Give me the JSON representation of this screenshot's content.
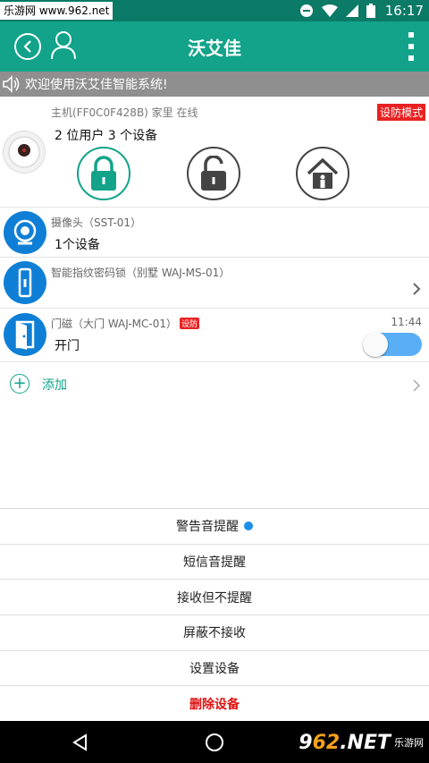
{
  "status_bar": {
    "watermark": "乐游网 www.962.net",
    "time": "16:17"
  },
  "header": {
    "title": "沃艾佳"
  },
  "notice": {
    "text": "欢迎使用沃艾佳智能系统!"
  },
  "host": {
    "subtitle": "主机(FF0C0F428B) 家里 在线",
    "summary": "2 位用户  3 个设备",
    "mode_badge": "设防模式"
  },
  "devices": [
    {
      "name": "摄像头（SST-01）",
      "status": "1个设备"
    },
    {
      "name": "智能指纹密码锁（别墅 WAJ-MS-01）",
      "status": ""
    },
    {
      "name": "门磁（大门 WAJ-MC-01）",
      "tag": "设防",
      "status": "开门",
      "time": "11:44",
      "toggle_on": true
    }
  ],
  "add": {
    "label": "添加"
  },
  "menu": [
    {
      "label": "警告音提醒",
      "selected": true
    },
    {
      "label": "短信音提醒"
    },
    {
      "label": "接收但不提醒"
    },
    {
      "label": "屏蔽不接收"
    },
    {
      "label": "设置设备"
    },
    {
      "label": "删除设备"
    }
  ],
  "watermark_bottom": {
    "logo_prefix": "9",
    "logo_num": "62",
    "logo_suffix": ".NET",
    "sub": "乐游网"
  },
  "colors": {
    "primary": "#12a38a",
    "status_bar": "#0b7a66",
    "danger": "#e82222",
    "device_blue": "#0f7fd6",
    "toggle": "#5aaef5"
  }
}
